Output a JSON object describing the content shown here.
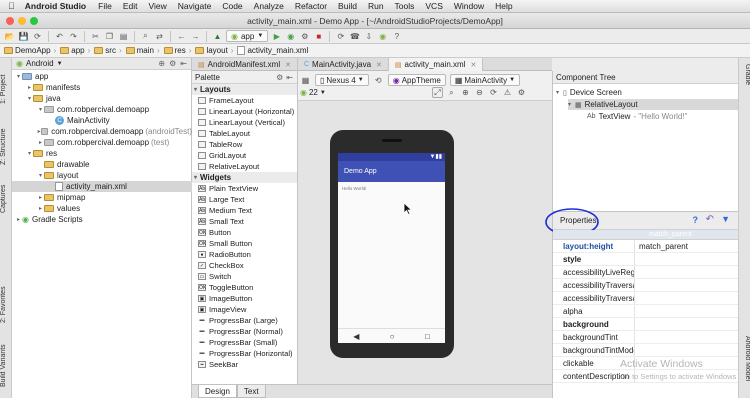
{
  "menubar": {
    "app_name": "Android Studio",
    "items": [
      "File",
      "Edit",
      "View",
      "Navigate",
      "Code",
      "Analyze",
      "Refactor",
      "Build",
      "Run",
      "Tools",
      "VCS",
      "Window",
      "Help"
    ]
  },
  "window": {
    "title": "activity_main.xml - Demo App - [~/AndroidStudioProjects/DemoApp]"
  },
  "toolbar": {
    "run_config": "app"
  },
  "breadcrumbs": [
    "DemoApp",
    "app",
    "src",
    "main",
    "res",
    "layout",
    "activity_main.xml"
  ],
  "left_strip": {
    "tabs": [
      "1: Project",
      "Z: Structure",
      "Captures",
      "2: Favorites",
      "Build Variants"
    ]
  },
  "right_strip": {
    "tabs": [
      "Gradle",
      "Android Model"
    ]
  },
  "project": {
    "view_mode": "Android",
    "tree": [
      {
        "label": "app",
        "hint": "",
        "icon": "folder-blue",
        "indent": 0,
        "arrow": "▾",
        "selected": false
      },
      {
        "label": "manifests",
        "hint": "",
        "icon": "folder-yellow",
        "indent": 1,
        "arrow": "▸",
        "selected": false
      },
      {
        "label": "java",
        "hint": "",
        "icon": "folder-yellow",
        "indent": 1,
        "arrow": "▾",
        "selected": false
      },
      {
        "label": "com.robpercival.demoapp",
        "hint": "",
        "icon": "folder-grey",
        "indent": 2,
        "arrow": "▾",
        "selected": false
      },
      {
        "label": "MainActivity",
        "hint": "",
        "icon": "class",
        "indent": 3,
        "arrow": "",
        "selected": false
      },
      {
        "label": "com.robpercival.demoapp",
        "hint": "(androidTest)",
        "icon": "folder-grey",
        "indent": 2,
        "arrow": "▸",
        "selected": false
      },
      {
        "label": "com.robpercival.demoapp",
        "hint": "(test)",
        "icon": "folder-grey",
        "indent": 2,
        "arrow": "▸",
        "selected": false
      },
      {
        "label": "res",
        "hint": "",
        "icon": "folder-yellow",
        "indent": 1,
        "arrow": "▾",
        "selected": false
      },
      {
        "label": "drawable",
        "hint": "",
        "icon": "folder-yellow",
        "indent": 2,
        "arrow": "",
        "selected": false
      },
      {
        "label": "layout",
        "hint": "",
        "icon": "folder-yellow",
        "indent": 2,
        "arrow": "▾",
        "selected": false
      },
      {
        "label": "activity_main.xml",
        "hint": "",
        "icon": "file",
        "indent": 3,
        "arrow": "",
        "selected": true
      },
      {
        "label": "mipmap",
        "hint": "",
        "icon": "folder-yellow",
        "indent": 2,
        "arrow": "▸",
        "selected": false
      },
      {
        "label": "values",
        "hint": "",
        "icon": "folder-yellow",
        "indent": 2,
        "arrow": "▸",
        "selected": false
      },
      {
        "label": "Gradle Scripts",
        "hint": "",
        "icon": "gradle",
        "indent": 0,
        "arrow": "▸",
        "selected": false
      }
    ]
  },
  "editor_tabs": [
    {
      "label": "AndroidManifest.xml",
      "active": false
    },
    {
      "label": "MainActivity.java",
      "active": false
    },
    {
      "label": "activity_main.xml",
      "active": true
    }
  ],
  "palette": {
    "title": "Palette",
    "groups": [
      {
        "name": "Layouts",
        "items": [
          "FrameLayout",
          "LinearLayout (Horizontal)",
          "LinearLayout (Vertical)",
          "TableLayout",
          "TableRow",
          "GridLayout",
          "RelativeLayout"
        ]
      },
      {
        "name": "Widgets",
        "items": [
          "Plain TextView",
          "Large Text",
          "Medium Text",
          "Small Text",
          "Button",
          "Small Button",
          "RadioButton",
          "CheckBox",
          "Switch",
          "ToggleButton",
          "ImageButton",
          "ImageView",
          "ProgressBar (Large)",
          "ProgressBar (Normal)",
          "ProgressBar (Small)",
          "ProgressBar (Horizontal)",
          "SeekBar"
        ]
      }
    ]
  },
  "design_toolbar": {
    "device": "Nexus 4",
    "theme": "AppTheme",
    "activity": "MainActivity",
    "api": "22"
  },
  "device_preview": {
    "app_title": "Demo App",
    "content_text": "Hello World!"
  },
  "bottom_tabs": [
    {
      "label": "Design",
      "active": true
    },
    {
      "label": "Text",
      "active": false
    }
  ],
  "component_tree": {
    "title": "Component Tree",
    "nodes": [
      {
        "label": "Device Screen",
        "indent": 0,
        "selected": false
      },
      {
        "label": "RelativeLayout",
        "indent": 1,
        "selected": true
      },
      {
        "label": "TextView",
        "extra": "- \"Hello World!\"",
        "indent": 2,
        "selected": false
      }
    ]
  },
  "properties": {
    "title": "Properties",
    "col_value_header": "match_parent",
    "rows": [
      {
        "name": "layout:height",
        "value": "match_parent",
        "style": "blue"
      },
      {
        "name": "style",
        "value": "",
        "style": "bold"
      },
      {
        "name": "accessibilityLiveRegion",
        "value": "",
        "style": ""
      },
      {
        "name": "accessibilityTraversalAfter",
        "value": "",
        "style": ""
      },
      {
        "name": "accessibilityTraversalBefore",
        "value": "",
        "style": ""
      },
      {
        "name": "alpha",
        "value": "",
        "style": ""
      },
      {
        "name": "background",
        "value": "",
        "style": "bold"
      },
      {
        "name": "backgroundTint",
        "value": "",
        "style": ""
      },
      {
        "name": "backgroundTintMode",
        "value": "",
        "style": ""
      },
      {
        "name": "clickable",
        "value": "",
        "style": ""
      },
      {
        "name": "contentDescription",
        "value": "",
        "style": ""
      }
    ]
  },
  "watermark": {
    "line1": "Activate Windows",
    "line2": "Go to Settings to activate Windows"
  },
  "colors": {
    "app_bar": "#3f51b5",
    "status_bar": "#303f9f",
    "annotation_circle": "#1c2fd8"
  }
}
